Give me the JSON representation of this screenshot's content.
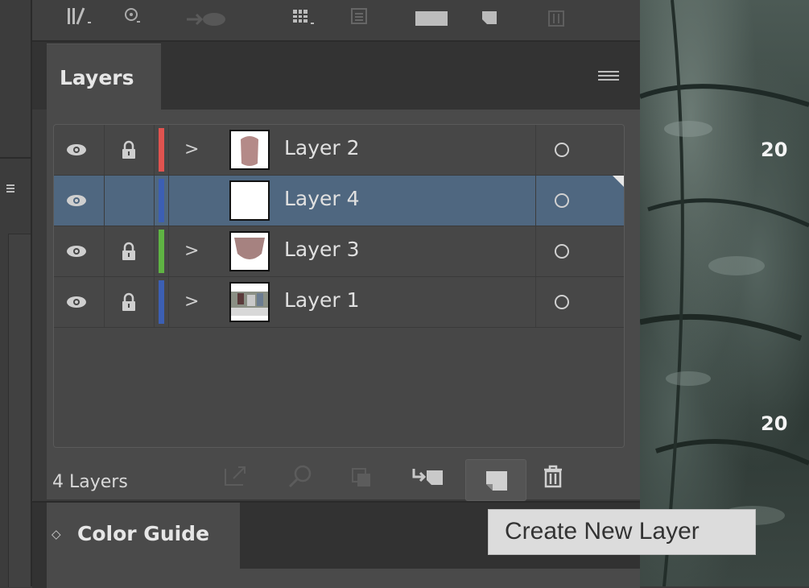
{
  "toolbar": {
    "icons": [
      "library-icon",
      "lasso-icon",
      "cloud-icon",
      "grid-icon",
      "list-icon",
      "square-icon",
      "new-layer-icon",
      "trash-icon"
    ]
  },
  "layers_panel": {
    "tab_label": "Layers",
    "menu_icon": "hamburger-icon",
    "rows": [
      {
        "name": "Layer 2",
        "color": "#e0534f",
        "locked": true,
        "expandable": true,
        "visible": true,
        "selected": false,
        "thumb": "shape-mauve"
      },
      {
        "name": "Layer 4",
        "color": "#3c5fb4",
        "locked": false,
        "expandable": false,
        "visible": true,
        "selected": true,
        "thumb": "blank"
      },
      {
        "name": "Layer 3",
        "color": "#5fb443",
        "locked": true,
        "expandable": true,
        "visible": true,
        "selected": false,
        "thumb": "shape-mauve-wide"
      },
      {
        "name": "Layer 1",
        "color": "#3c5fb4",
        "locked": true,
        "expandable": true,
        "visible": true,
        "selected": false,
        "thumb": "photo"
      }
    ],
    "footer": {
      "count_label": "4 Layers",
      "buttons": [
        "export-icon",
        "search-icon",
        "clip-mask-icon",
        "move-to-layer-icon",
        "create-new-layer-icon",
        "delete-icon"
      ]
    }
  },
  "color_guide": {
    "tab_label": "Color Guide",
    "arrows_glyph": "◇"
  },
  "tooltip": {
    "text": "Create New Layer"
  },
  "canvas": {
    "year_labels": [
      "20",
      "20"
    ]
  },
  "colors": {
    "selection": "#4f6780",
    "panel": "#4a4a4a"
  }
}
